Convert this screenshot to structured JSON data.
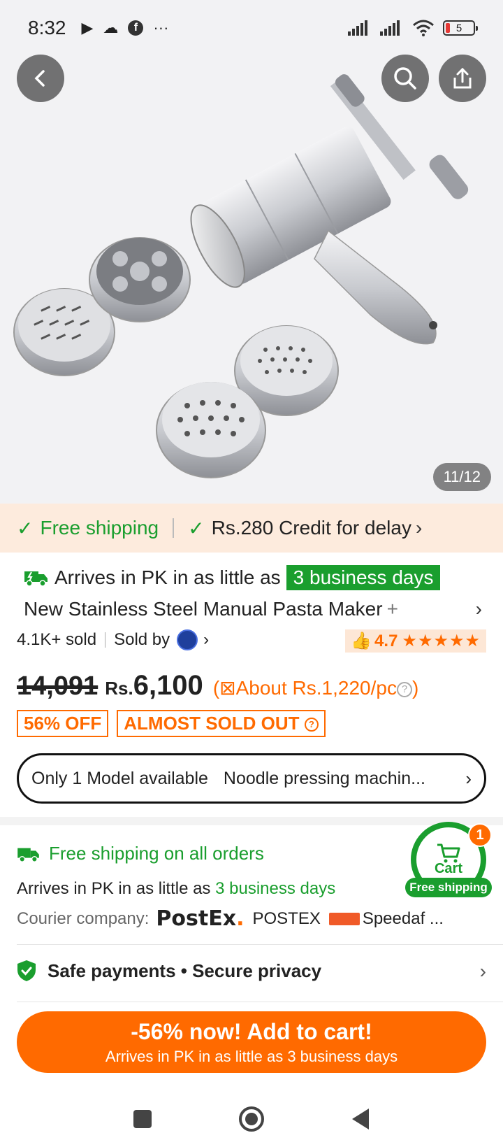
{
  "status_bar": {
    "time": "8:32",
    "battery_level": "5",
    "icons": [
      "play-store-icon",
      "cloud-icon",
      "facebook-icon",
      "more-icon"
    ]
  },
  "gallery": {
    "counter": "11/12"
  },
  "promo": {
    "free_shipping": "Free shipping",
    "credit": "Rs.280 Credit for delay"
  },
  "product": {
    "arrive_prefix": "Arrives in PK in as little as",
    "arrive_highlight": "3 business days",
    "title": "New Stainless Steel Manual Pasta Maker",
    "title_plus": "+",
    "sold": "4.1K+ sold",
    "sold_by": "Sold by",
    "rating": "4.7",
    "stars": "★★★★★"
  },
  "price": {
    "original": "14,091",
    "currency": "Rs.",
    "current": "6,100",
    "per_piece": "About Rs.1,220/pc",
    "open_paren": "(",
    "close_paren": ")"
  },
  "badges": {
    "discount": "56% OFF",
    "stock": "ALMOST SOLD OUT"
  },
  "model": {
    "available": "Only 1 Model available",
    "option": "Noodle pressing machin..."
  },
  "shipping": {
    "title": "Free shipping on all orders",
    "arrive_prefix": "Arrives in PK in as little as",
    "arrive_days": "3 business days",
    "courier_label": "Courier company:",
    "postex_logo": "PostEx",
    "postex_name": "POSTEX",
    "speedaf_name": "Speedaf ..."
  },
  "cart": {
    "label": "Cart",
    "count": "1",
    "free": "Free shipping"
  },
  "safety": {
    "text": "Safe payments • Secure privacy"
  },
  "cta": {
    "main": "-56% now! Add to cart!",
    "sub": "Arrives in PK in as little as 3 business days"
  },
  "colors": {
    "accent_orange": "#ff6a00",
    "green": "#1a9e2e",
    "promo_bg": "#fdebdd"
  }
}
